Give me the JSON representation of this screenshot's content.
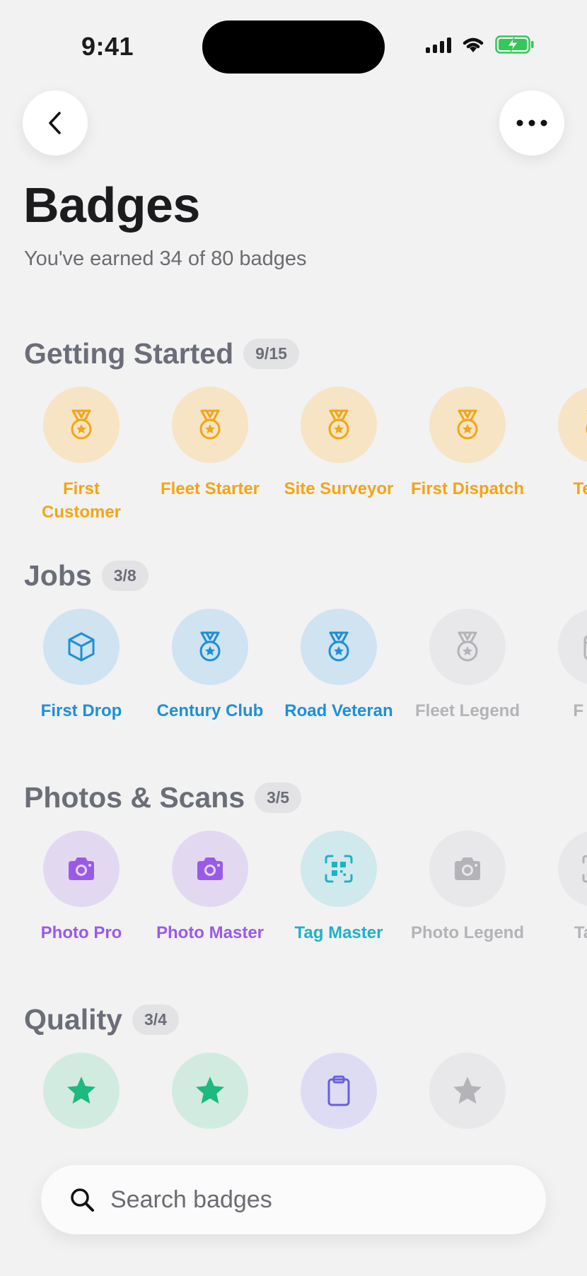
{
  "status": {
    "time": "9:41"
  },
  "page": {
    "title": "Badges",
    "subtitle": "You've earned 34 of 80 badges"
  },
  "sections": [
    {
      "title": "Getting Started",
      "count": "9/15",
      "badges": [
        {
          "label": "First Customer",
          "icon": "medal-icon",
          "color": "orange",
          "earned": true
        },
        {
          "label": "Fleet Starter",
          "icon": "medal-icon",
          "color": "orange",
          "earned": true
        },
        {
          "label": "Site Surveyor",
          "icon": "medal-icon",
          "color": "orange",
          "earned": true
        },
        {
          "label": "First Dispatch",
          "icon": "medal-icon",
          "color": "orange",
          "earned": true
        },
        {
          "label": "Te Bu",
          "icon": "medal-icon",
          "color": "orange",
          "earned": true
        }
      ]
    },
    {
      "title": "Jobs",
      "count": "3/8",
      "badges": [
        {
          "label": "First Drop",
          "icon": "box-icon",
          "color": "blue",
          "earned": true
        },
        {
          "label": "Century Club",
          "icon": "medal-icon",
          "color": "blue",
          "earned": true
        },
        {
          "label": "Road Veteran",
          "icon": "medal-icon",
          "color": "blue",
          "earned": true
        },
        {
          "label": "Fleet Legend",
          "icon": "medal-icon",
          "color": "gray",
          "earned": false
        },
        {
          "label": "F Sch",
          "icon": "calendar-icon",
          "color": "gray",
          "earned": false
        }
      ]
    },
    {
      "title": "Photos & Scans",
      "count": "3/5",
      "badges": [
        {
          "label": "Photo Pro",
          "icon": "camera-icon",
          "color": "purple",
          "earned": true
        },
        {
          "label": "Photo Master",
          "icon": "camera-icon",
          "color": "purple",
          "earned": true
        },
        {
          "label": "Tag Master",
          "icon": "qr-scan-icon",
          "color": "teal",
          "earned": true
        },
        {
          "label": "Photo Legend",
          "icon": "camera-icon",
          "color": "gray",
          "earned": false
        },
        {
          "label": "Tag L",
          "icon": "qr-scan-icon",
          "color": "gray",
          "earned": false
        }
      ]
    },
    {
      "title": "Quality",
      "count": "3/4",
      "badges": [
        {
          "label": "",
          "icon": "star-icon",
          "color": "green",
          "earned": true
        },
        {
          "label": "",
          "icon": "star-icon",
          "color": "green",
          "earned": true
        },
        {
          "label": "",
          "icon": "clipboard-icon",
          "color": "indigo",
          "earned": true
        },
        {
          "label": "",
          "icon": "star-icon",
          "color": "gray",
          "earned": false
        }
      ]
    }
  ],
  "search": {
    "placeholder": "Search badges"
  },
  "colors": {
    "orange": "#f2a516",
    "blue": "#1e90d6",
    "purple": "#9a5ae8",
    "teal": "#1fb1c7",
    "green": "#1db97e",
    "indigo": "#6a5fe0",
    "gray": "#b3b3b8"
  }
}
